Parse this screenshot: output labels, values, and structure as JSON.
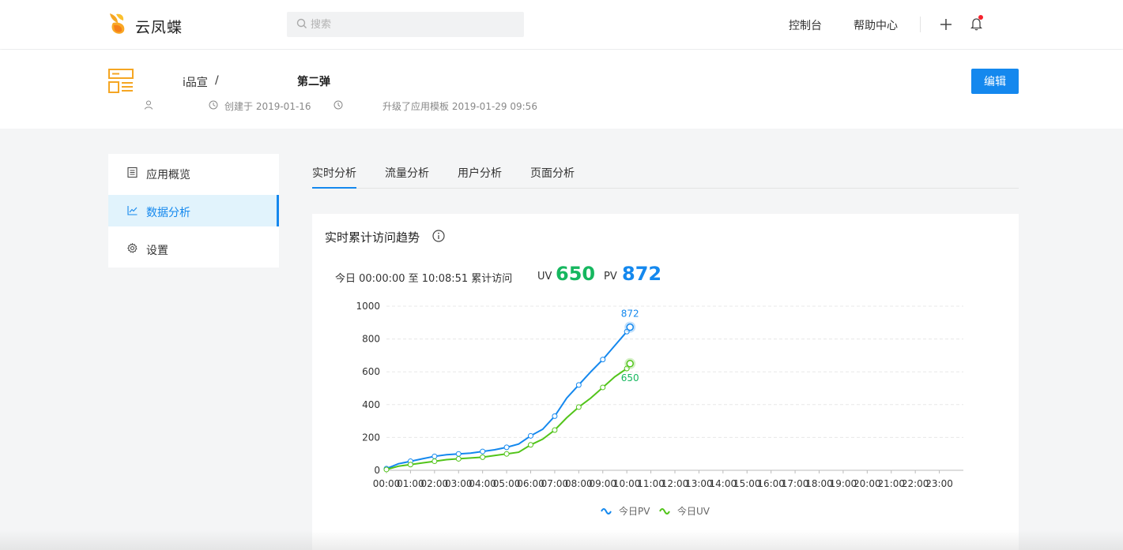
{
  "topbar": {
    "brand": "云凤蝶",
    "search_placeholder": "搜索",
    "console_label": "控制台",
    "help_label": "帮助中心"
  },
  "header": {
    "breadcrumb_parent": "i品宣",
    "breadcrumb_sep": "/",
    "breadcrumb_current": "第二弹",
    "created": "创建于 2019-01-16",
    "upgraded": "升级了应用模板 2019-01-29 09:56",
    "edit_label": "编辑"
  },
  "sidebar": {
    "items": [
      {
        "label": "应用概览",
        "icon": "overview-icon"
      },
      {
        "label": "数据分析",
        "icon": "line-chart-icon",
        "active": true
      },
      {
        "label": "设置",
        "icon": "gear-icon"
      }
    ]
  },
  "tabs": [
    "实时分析",
    "流量分析",
    "用户分析",
    "页面分析"
  ],
  "card": {
    "title": "实时累计访问趋势",
    "range": "今日 00:00:00 至 10:08:51 累计访问",
    "uv_label": "UV",
    "uv_value": "650",
    "pv_label": "PV",
    "pv_value": "872"
  },
  "colors": {
    "accent": "#1488ee",
    "pv": "#1488ee",
    "uv": "#52c41a",
    "uv_text": "#16b75f"
  },
  "chart_data": {
    "type": "line",
    "x": [
      "00:00",
      "00:30",
      "01:00",
      "01:30",
      "02:00",
      "02:30",
      "03:00",
      "03:30",
      "04:00",
      "04:30",
      "05:00",
      "05:30",
      "06:00",
      "06:30",
      "07:00",
      "07:30",
      "08:00",
      "08:30",
      "09:00",
      "09:30",
      "10:00",
      "10:08"
    ],
    "categories": [
      "00:00",
      "01:00",
      "02:00",
      "03:00",
      "04:00",
      "05:00",
      "06:00",
      "07:00",
      "08:00",
      "09:00",
      "10:00",
      "11:00",
      "12:00",
      "13:00",
      "14:00",
      "15:00",
      "16:00",
      "17:00",
      "18:00",
      "19:00",
      "20:00",
      "21:00",
      "22:00",
      "23:00"
    ],
    "series": [
      {
        "name": "今日PV",
        "values": [
          10,
          40,
          55,
          70,
          85,
          95,
          100,
          105,
          115,
          125,
          140,
          160,
          210,
          250,
          330,
          440,
          520,
          600,
          675,
          760,
          845,
          872
        ]
      },
      {
        "name": "今日UV",
        "values": [
          5,
          25,
          35,
          45,
          55,
          65,
          70,
          75,
          80,
          90,
          100,
          110,
          155,
          190,
          245,
          320,
          385,
          440,
          505,
          570,
          620,
          650
        ]
      }
    ],
    "end_labels": {
      "pv": "872",
      "uv": "650"
    },
    "ylim": [
      0,
      1000
    ],
    "yticks": [
      0,
      200,
      400,
      600,
      800,
      1000
    ],
    "grid": true,
    "legend": "bottom"
  }
}
